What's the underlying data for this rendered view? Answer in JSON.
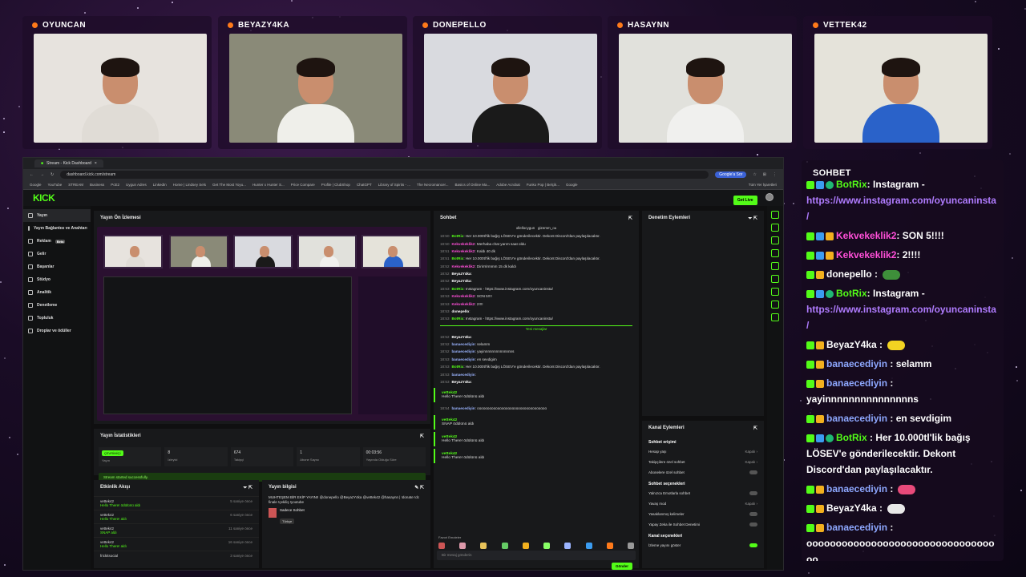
{
  "cams": [
    {
      "name": "OYUNCAN"
    },
    {
      "name": "BEYAZY4KA"
    },
    {
      "name": "DONEPELLO"
    },
    {
      "name": "HASAYNN"
    },
    {
      "name": "VETTEK42"
    }
  ],
  "browser": {
    "tab_title": "Stream - Kick Dashboard",
    "url": "dashboard.kick.com/stream",
    "google_ask": "Google'a Sor",
    "bookmarks": [
      "Google",
      "YouTube",
      "STREAM",
      "Business",
      "PcE2",
      "Uygun Adres",
      "LinkedIn",
      "Home | Lindsey Sels",
      "Get The Most Yoyu...",
      "Hunter x Hunter S...",
      "Price Compare",
      "Profile | ClubShop",
      "ChatGPT",
      "Library of Spirits - ...",
      "The Necromancer...",
      "Basics of Online Ma...",
      "Adobe Acrobat",
      "Funko Pop | Belçik...",
      "Google"
    ],
    "other_bookmarks": "Tüm Yer İşaretleri"
  },
  "kick": {
    "logo": "KICK",
    "go_live": "Get Live",
    "sidebar": [
      {
        "label": "Yayın",
        "active": true
      },
      {
        "label": "Yayın Bağlantısı ve Anahtarı"
      },
      {
        "label": "Reklam",
        "badge": "Beta"
      },
      {
        "label": "Gelir"
      },
      {
        "label": "Başarılar"
      },
      {
        "label": "Stüdyo"
      },
      {
        "label": "Analitik"
      },
      {
        "label": "Denetleme"
      },
      {
        "label": "Topluluk"
      },
      {
        "label": "Droplar ve ödüller"
      }
    ],
    "preview_title": "Yayın Ön İzlemesi",
    "stats_title": "Yayın İstatistikleri",
    "stats": [
      {
        "value": "ÇEVRİMİÇİ",
        "label": "Yayın"
      },
      {
        "value": "8",
        "label": "İzleyici"
      },
      {
        "value": "674",
        "label": "Takipçi"
      },
      {
        "value": "1",
        "label": "Abone Sayısı"
      },
      {
        "value": "00:03:56",
        "label": "Yayında Olduğu Süre"
      }
    ],
    "toast": "Stream started successfully.",
    "activity_title": "Etkinlik Akışı",
    "activity": [
      {
        "user": "vettek42",
        "msg": "Hello There! ödülünü aldı",
        "time": "5 saniye önce"
      },
      {
        "user": "vettek42",
        "msg": "Hello There! aldı",
        "time": "6 saniye önce"
      },
      {
        "user": "vettek42",
        "msg": "SNAP aldı",
        "time": "11 saniye önce"
      },
      {
        "user": "vettek42",
        "msg": "Hello There! aldı",
        "time": "16 saniye önce"
      },
      {
        "user": "frickitsocial",
        "msg": "",
        "time": "3 saniye önce"
      }
    ],
    "info_title": "Yayın bilgisi",
    "info_text": "MUHTEŞEM BİR EKİP YAYINI! @donepello @BeyazY4ka @vettek42 @hasaynn | !donate !dc finale !çekiliş !youtube",
    "info_chip": "Sadece Sohbet",
    "info_tag": "Türkçe",
    "chat_title": "Sohbet",
    "pinned": [
      "ollellocygun",
      "gizemm_ou"
    ],
    "chat": [
      {
        "t": "18:50",
        "u": "BotRix",
        "m": ": Her 10.000tl'lik bağış LÖSEV'e gönderilecektir. Dekont Discord'dan paylaşılacaktır.",
        "c": "#53fc18"
      },
      {
        "t": "18:50",
        "u": "Kekvekeklik2",
        "m": ": Merhaba chat yarım saat oldu",
        "c": "#ff4fd8"
      },
      {
        "t": "18:51",
        "u": "Kekvekeklik2",
        "m": ": Kaldı 40 dk",
        "c": "#ff4fd8"
      },
      {
        "t": "18:51",
        "u": "BotRix",
        "m": ": Her 10.000tl'lik bağış LÖSEV'e gönderilecektir. Dekont Discord'dan paylaşılacaktır.",
        "c": "#53fc18"
      },
      {
        "t": "18:52",
        "u": "Kekvekeklik2",
        "m": ": Dirirrrirmmm 15 dk kaldı",
        "c": "#ff4fd8"
      },
      {
        "t": "18:52",
        "u": "BeyazY4ka",
        "m": ":",
        "c": "#fff"
      },
      {
        "t": "18:52",
        "u": "BeyazY4ka",
        "m": ":",
        "c": "#fff"
      },
      {
        "t": "18:53",
        "u": "BotRix",
        "m": ": Instagram - https://www.instagram.com/oyuncaninsta/",
        "c": "#53fc18"
      },
      {
        "t": "18:53",
        "u": "Kekvekeklik2",
        "m": ": SON 5!!!!",
        "c": "#ff4fd8"
      },
      {
        "t": "18:53",
        "u": "Kekvekeklik2",
        "m": ": 2!!!!",
        "c": "#ff4fd8"
      },
      {
        "t": "18:53",
        "u": "donepello",
        "m": ":",
        "c": "#fff"
      },
      {
        "t": "18:53",
        "u": "BotRix",
        "m": ": Instagram - https://www.instagram.com/oyuncaninsta/",
        "c": "#53fc18"
      }
    ],
    "new_messages": "Yeni mesajlar",
    "chat2": [
      {
        "t": "18:52",
        "u": "BeyazY4ka",
        "m": ":",
        "c": "#fff"
      },
      {
        "t": "18:52",
        "u": "banaecediyin",
        "m": ": selamm",
        "c": "#9bb4ff"
      },
      {
        "t": "18:52",
        "u": "banaecediyin",
        "m": ": yayinnnnnnnnnnnnnns",
        "c": "#9bb4ff"
      },
      {
        "t": "18:53",
        "u": "banaecediyin",
        "m": ": en sevdigim",
        "c": "#9bb4ff"
      },
      {
        "t": "18:53",
        "u": "BotRix",
        "m": ": Her 10.000tl'lik bağış LÖSEV'e gönderilecektir. Dekont Discord'dan paylaşılacaktır.",
        "c": "#53fc18"
      },
      {
        "t": "18:53",
        "u": "banaecediyin",
        "m": ":",
        "c": "#9bb4ff"
      },
      {
        "t": "18:53",
        "u": "BeyazY4ka",
        "m": ":",
        "c": "#fff"
      }
    ],
    "sys": [
      {
        "u": "vettek42",
        "m": "Hello There! ödülünü aldı"
      },
      {
        "u": "vettek42",
        "m": "SNAP ödülünü aldı"
      },
      {
        "u": "vettek42",
        "m": "Hello There! ödülünü aldı"
      },
      {
        "u": "vettek42",
        "m": "Hello There! ödülünü aldı"
      }
    ],
    "sys_chat": {
      "t": "18:54",
      "u": "banaecediyin",
      "m": ": oooooooooooooooooooooooooooooooooo",
      "c": "#9bb4ff"
    },
    "chat_placeholder": "Bir mesaj gönderin",
    "send": "Gönder",
    "fav_emotes": "Favori Emoteler",
    "mod_title": "Denetim Eylemleri",
    "channel_title": "Kanal Eylemleri",
    "chat_access": "Sohbet erişimi",
    "settings": [
      {
        "label": "Hesap yaşı",
        "value": "Kapalı"
      },
      {
        "label": "Takipçilere özel sohbet",
        "value": "Kapalı"
      },
      {
        "label": "Abonelere özel sohbet",
        "value": ""
      }
    ],
    "chat_options": "Sohbet seçenekleri",
    "settings2": [
      {
        "label": "Yalnızca Emotlarla sohbet",
        "value": ""
      },
      {
        "label": "Yavaş mod",
        "value": "Kapalı"
      },
      {
        "label": "Yasaklanmış kelimeler",
        "value": ""
      },
      {
        "label": "Yapay Zeka ile Sohbet Denetimi",
        "value": ""
      }
    ],
    "channel_options": "Kanal seçenekleri",
    "host_mode": "İzleme yayını göster"
  },
  "overlay": {
    "title": "SOHBET",
    "messages": [
      {
        "user": "BotRix",
        "color": "#53fc18",
        "text": ": Instagram - ",
        "link": "https://www.instagram.com/oyuncaninsta/",
        "badges": [
          "g",
          "b",
          "c"
        ]
      },
      {
        "user": "Kekvekeklik2",
        "color": "#ff4fd8",
        "text": ": SON 5!!!!",
        "badges": [
          "g",
          "b",
          "y"
        ]
      },
      {
        "user": "Kekvekeklik2",
        "color": "#ff4fd8",
        "text": ": 2!!!!",
        "badges": [
          "g",
          "b",
          "y"
        ]
      },
      {
        "user": "donepello",
        "color": "#ffffff",
        "text": " :",
        "emote": "#3e8f3a",
        "badges": [
          "g",
          "y"
        ]
      },
      {
        "user": "BotRix",
        "color": "#53fc18",
        "text": ": Instagram - ",
        "link": "https://www.instagram.com/oyuncaninsta/",
        "badges": [
          "g",
          "b",
          "c"
        ]
      },
      {
        "user": "BeyazY4ka",
        "color": "#ffffff",
        "text": " :",
        "emote": "#f2d322",
        "badges": [
          "g",
          "y"
        ]
      },
      {
        "user": "banaecediyin",
        "color": "#8ea8ff",
        "text": " : selamm",
        "badges": [
          "g",
          "y"
        ]
      },
      {
        "user": "banaecediyin",
        "color": "#8ea8ff",
        "text": " : yayinnnnnnnnnnnnnnns",
        "badges": [
          "g",
          "y"
        ]
      },
      {
        "user": "banaecediyin",
        "color": "#8ea8ff",
        "text": " : en sevdigim",
        "badges": [
          "g",
          "y"
        ]
      },
      {
        "user": "BotRix",
        "color": "#53fc18",
        "text": " : Her 10.000tl'lik bağış LÖSEV'e gönderilecektir. Dekont Discord'dan paylaşılacaktır.",
        "badges": [
          "g",
          "b",
          "c"
        ]
      },
      {
        "user": "banaecediyin",
        "color": "#8ea8ff",
        "text": " :",
        "emote": "#e84a7a",
        "badges": [
          "g",
          "y"
        ]
      },
      {
        "user": "BeyazY4ka",
        "color": "#ffffff",
        "text": " :",
        "emote": "#e8e8e8",
        "badges": [
          "g",
          "y"
        ]
      },
      {
        "user": "banaecediyin",
        "color": "#8ea8ff",
        "text": " : oooooooooooooooooooooooooooooooooo",
        "badges": [
          "g",
          "y"
        ]
      }
    ]
  },
  "colors": {
    "kick_green": "#53fc18",
    "accent_orange": "#ff7a1a",
    "link_purple": "#b07cff"
  }
}
